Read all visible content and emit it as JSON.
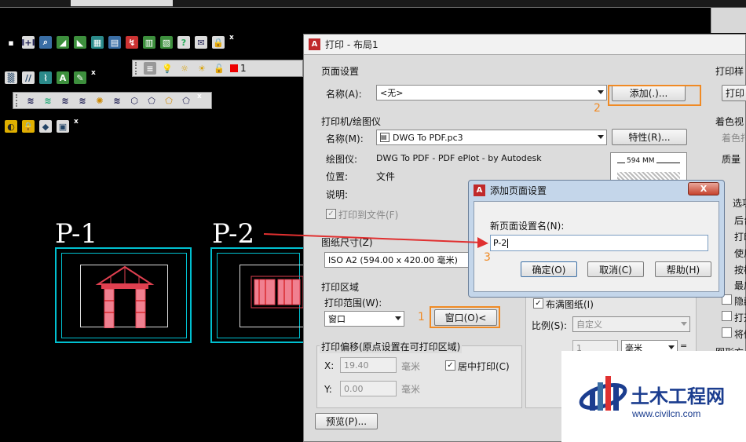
{
  "toolbars": {
    "layer_value": "1"
  },
  "layouts": [
    {
      "label": "P-1"
    },
    {
      "label": "P-2"
    }
  ],
  "main_dialog": {
    "title": "打印 - 布局1",
    "page_setup": {
      "group_label": "页面设置",
      "name_label": "名称(A):",
      "name_value": "<无>",
      "add_button": "添加(.)..."
    },
    "printer": {
      "group_label": "打印机/绘图仪",
      "name_label": "名称(M):",
      "name_value": "DWG To PDF.pc3",
      "properties_button": "特性(R)...",
      "plotter_label": "绘图仪:",
      "plotter_value": "DWG To PDF - PDF ePlot - by Autodesk",
      "location_label": "位置:",
      "location_value": "文件",
      "description_label": "说明:",
      "print_to_file_label": "打印到文件(F)",
      "preview_dimension": "594 MM"
    },
    "paper_size": {
      "group_label": "图纸尺寸(Z)",
      "value": "ISO A2 (594.00 x 420.00 毫米)"
    },
    "print_area": {
      "group_label": "打印区域",
      "range_label": "打印范围(W):",
      "range_value": "窗口",
      "window_button": "窗口(O)<"
    },
    "print_offset": {
      "group_label": "打印偏移(原点设置在可打印区域)",
      "x_label": "X:",
      "x_value": "19.40",
      "y_label": "Y:",
      "y_value": "0.00",
      "unit": "毫米",
      "center_label": "居中打印(C)"
    },
    "scale": {
      "fit_label": "布满图纸(I)",
      "scale_label": "比例(S):",
      "scale_value": "自定义",
      "value1": "1",
      "unit_value": "毫米"
    },
    "preview_button": "预览(P)...",
    "right_column": {
      "plot_style_label": "打印样",
      "plot_style_button": "打印",
      "shaded_label": "着色视",
      "shaded_sub": "着色打",
      "quality_label": "质量",
      "options_label": "选项",
      "opt1": "后台",
      "opt2": "打印",
      "opt3": "使用",
      "opt4": "按样",
      "opt5": "最后",
      "opt6": "隐藏",
      "opt7": "打开",
      "opt8": "将修",
      "orientation_label": "图形方"
    }
  },
  "sub_dialog": {
    "title": "添加页面设置",
    "close": "X",
    "name_label": "新页面设置名(N):",
    "name_value": "P-2",
    "ok_button": "确定(O)",
    "cancel_button": "取消(C)",
    "help_button": "帮助(H)"
  },
  "annotations": {
    "step1": "1",
    "step2": "2",
    "step3": "3",
    "color": "#f08a24",
    "arrow_color": "#e03030"
  },
  "watermark": {
    "title": "土木工程网",
    "url": "www.civilcn.com"
  }
}
